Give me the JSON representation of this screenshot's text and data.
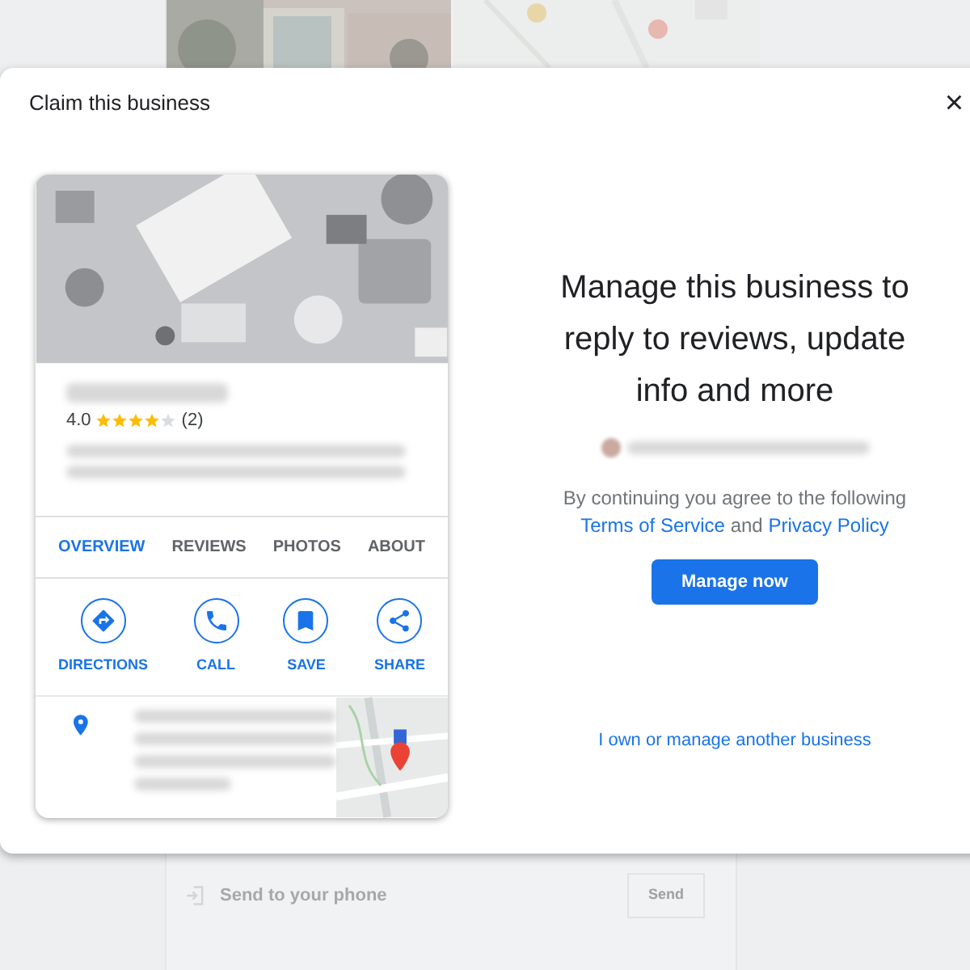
{
  "background": {
    "send_row": {
      "label": "Send to your phone",
      "button": "Send"
    }
  },
  "dialog": {
    "title": "Claim this business",
    "close": "×",
    "card": {
      "rating": "4.0",
      "stars": 4,
      "review_count": "(2)",
      "tabs": [
        {
          "label": "OVERVIEW",
          "selected": true
        },
        {
          "label": "REVIEWS",
          "selected": false
        },
        {
          "label": "PHOTOS",
          "selected": false
        },
        {
          "label": "ABOUT",
          "selected": false
        }
      ],
      "actions": [
        {
          "kind": "directions",
          "label": "DIRECTIONS"
        },
        {
          "kind": "call",
          "label": "CALL"
        },
        {
          "kind": "save",
          "label": "SAVE"
        },
        {
          "kind": "share",
          "label": "SHARE"
        }
      ]
    },
    "heading": "Manage this business to reply to reviews, update info and more",
    "consent": {
      "text": "By continuing you agree to the following",
      "terms_link": "Terms of Service",
      "and": "and",
      "privacy_link": "Privacy Policy"
    },
    "primary_button": "Manage now",
    "secondary_link": "I own or manage another business"
  }
}
